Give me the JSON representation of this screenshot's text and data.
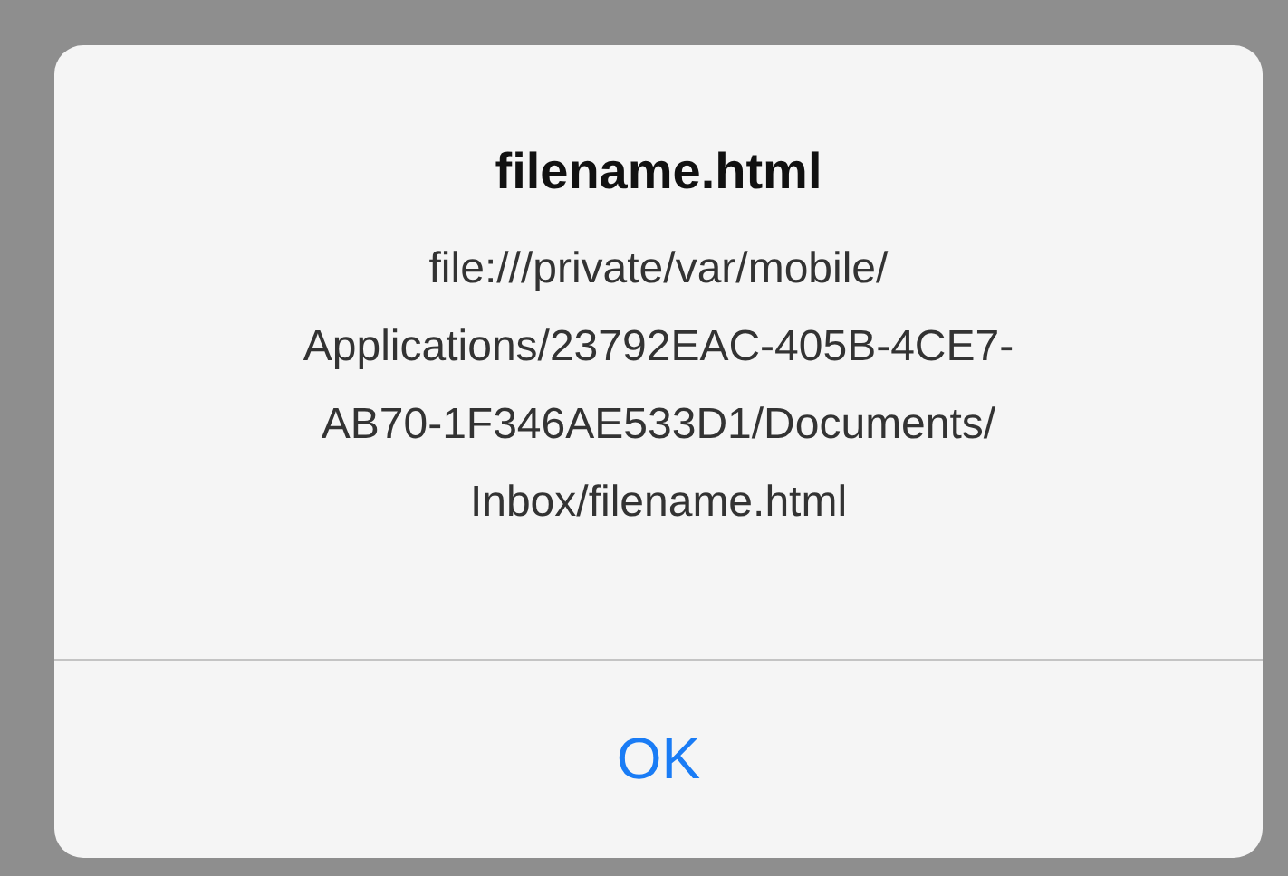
{
  "alert": {
    "title": "filename.html",
    "message_lines": [
      "file:///private/var/mobile/",
      "Applications/23792EAC-405B-4CE7-",
      "AB70-1F346AE533D1/Documents/",
      "Inbox/filename.html"
    ],
    "buttons": [
      {
        "label": "OK"
      }
    ]
  }
}
